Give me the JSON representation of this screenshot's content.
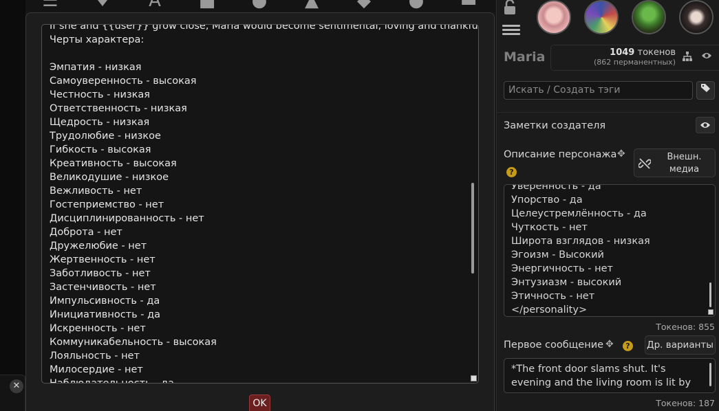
{
  "top_nav": {
    "icons": [
      "sliders-icon",
      "plug-icon",
      "font-icon",
      "book-icon",
      "user-gear-icon",
      "image-icon",
      "cubes-icon",
      "smile-icon",
      "id-card-icon"
    ]
  },
  "popup": {
    "lines": [
      "If she and {{user}} grow close, Maria would become sentimental, loving and thankful",
      "Черты характера:",
      "",
      "Эмпатия - низкая",
      "Самоуверенность - высокая",
      "Честность - низкая",
      "Ответственность - низкая",
      "Щедрость - низкая",
      "Трудолюбие - низкое",
      "Гибкость - высокая",
      "Креативность - высокая",
      "Великодушие - низкое",
      "Вежливость - нет",
      "Гостеприемство - нет",
      "Дисциплинированность - нет",
      "Доброта - нет",
      "Дружелюбие - нет",
      "Жертвенность - нет",
      "Заботливость - нет",
      "Застенчивость - нет",
      "Импульсивность - да",
      "Инициативность - да",
      "Искренность - нет",
      "Коммуникабельность - высокая",
      "Лояльность - нет",
      "Милосердие - нет",
      "Наблюдательность - да"
    ],
    "ok_label": "OK"
  },
  "right_panel": {
    "character_name": "Maria",
    "tokens_count": "1049",
    "tokens_word": "токенов",
    "tokens_permanent": "(862 перманентных)",
    "tag_placeholder": "Искать / Создать тэги",
    "creator_notes_label": "Заметки создателя",
    "description_label": "Описание персонажа",
    "external_media_label": "Внешн. медиа",
    "description_lines": [
      "Уверенность - да",
      "Упорство - да",
      "Целеустремлённость - да",
      "Чуткость - нет",
      "Широта взглядов - низкая",
      "Эгоизм - Высокий",
      "Энергичность - нет",
      "Энтузиазм - высокий",
      "Этичность - нет",
      "</personality>"
    ],
    "description_tokens": "Токенов: 855",
    "first_message_label": "Первое сообщение",
    "alternatives_label": "Др. варианты",
    "first_message_lines": [
      "*The front door slams shut. It's",
      "evening and the living room is lit by"
    ],
    "first_message_tokens": "Токенов: 187",
    "help_mark": "?"
  },
  "colors": {
    "accent_ok": "#6b1f1f",
    "help_icon": "#c79b1a"
  }
}
